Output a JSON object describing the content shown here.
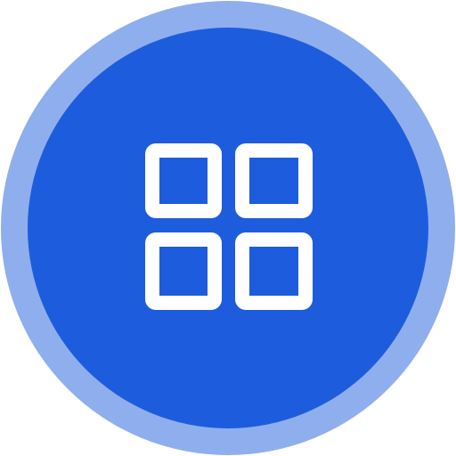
{
  "app_icon": {
    "icon": "grid-icon",
    "colors": {
      "outer_ring": "#8FAEEE",
      "inner_disc": "#1D5CDD",
      "glyph": "#FFFFFF"
    }
  }
}
